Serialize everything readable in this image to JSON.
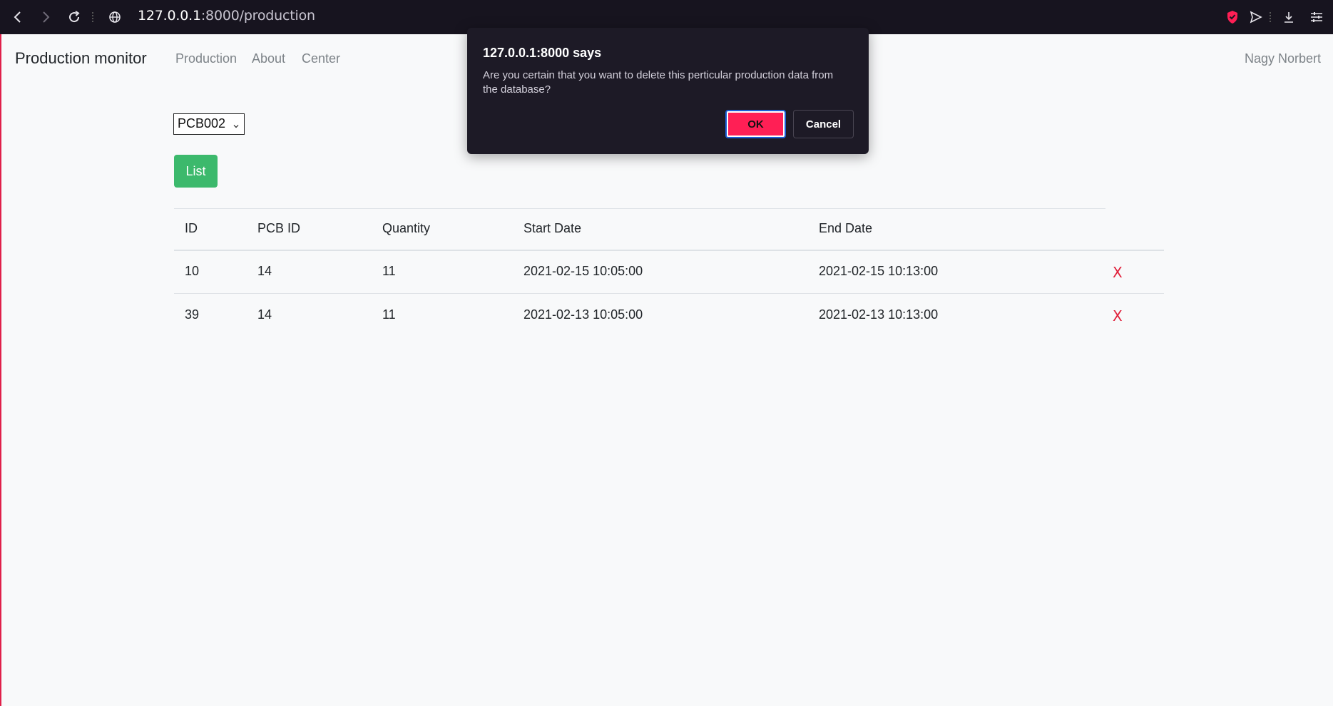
{
  "browser": {
    "url_host": "127.0.0.1",
    "url_rest": ":8000/production",
    "icons": [
      "back-icon",
      "forward-icon",
      "reload-icon",
      "globe-icon",
      "shield-icon",
      "send-icon",
      "download-icon",
      "settings-icon"
    ]
  },
  "navbar": {
    "brand": "Production monitor",
    "links": [
      "Production",
      "About",
      "Center"
    ],
    "user": "Nagy Norbert"
  },
  "filter": {
    "selected": "PCB002",
    "list_label": "List"
  },
  "table": {
    "headers": [
      "ID",
      "PCB ID",
      "Quantity",
      "Start Date",
      "End Date"
    ],
    "rows": [
      {
        "id": "10",
        "pcb_id": "14",
        "quantity": "11",
        "start": "2021-02-15 10:05:00",
        "end": "2021-02-15 10:13:00",
        "delete": "X"
      },
      {
        "id": "39",
        "pcb_id": "14",
        "quantity": "11",
        "start": "2021-02-13 10:05:00",
        "end": "2021-02-13 10:13:00",
        "delete": "X"
      }
    ]
  },
  "dialog": {
    "title": "127.0.0.1:8000 says",
    "message": "Are you certain that you want to delete this perticular production data from the database?",
    "ok": "OK",
    "cancel": "Cancel"
  },
  "colors": {
    "accent_ok": "#ff1f55",
    "list_button": "#3cb96c",
    "delete": "#e0203a",
    "browser_bar": "#17141f"
  }
}
